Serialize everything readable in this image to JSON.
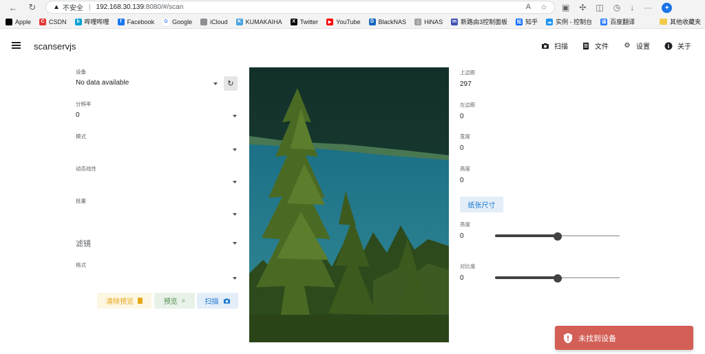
{
  "browser": {
    "insecure_label": "不安全",
    "url_host": "192.168.30.139",
    "url_path": ":8080/#/scan",
    "bookmarks": [
      {
        "label": "Apple",
        "color": "#000000",
        "glyph": ""
      },
      {
        "label": "CSDN",
        "color": "#e53935",
        "glyph": "C"
      },
      {
        "label": "哔哩哔哩",
        "color": "#00a1d6",
        "glyph": "b"
      },
      {
        "label": "Facebook",
        "color": "#1877f2",
        "glyph": "f"
      },
      {
        "label": "Google",
        "color": "#ffffff",
        "glyph": "G"
      },
      {
        "label": "iCloud",
        "color": "#8e8e93",
        "glyph": ""
      },
      {
        "label": "KUMAKAIHA",
        "color": "#4aa3df",
        "glyph": "K"
      },
      {
        "label": "Twitter",
        "color": "#000000",
        "glyph": "X"
      },
      {
        "label": "YouTube",
        "color": "#ff0000",
        "glyph": "▶"
      },
      {
        "label": "BlackNAS",
        "color": "#1565c0",
        "glyph": "D"
      },
      {
        "label": "HiNAS",
        "color": "#9e9e9e",
        "glyph": "▯"
      },
      {
        "label": "新路由3控制面板",
        "color": "#3f51b5",
        "glyph": "m"
      },
      {
        "label": "知乎",
        "color": "#0066ff",
        "glyph": "知"
      },
      {
        "label": "实例 - 控制台",
        "color": "#2196f3",
        "glyph": "☁"
      },
      {
        "label": "百度翻译",
        "color": "#2979ff",
        "glyph": "译"
      }
    ],
    "other_bookmarks": "其他收藏夹"
  },
  "app": {
    "title": "scanservjs",
    "menu": {
      "scan": "扫描",
      "files": "文件",
      "settings": "设置",
      "about": "关于"
    }
  },
  "form": {
    "device": {
      "label": "设备",
      "value": "No data available"
    },
    "resolution": {
      "label": "分辨率",
      "value": "0"
    },
    "mode": {
      "label": "模式",
      "value": ""
    },
    "dynamic_lineart": {
      "label": "动态线性",
      "value": ""
    },
    "batch": {
      "label": "批量",
      "value": ""
    },
    "filters": {
      "label": "滤镜"
    },
    "format": {
      "label": "格式",
      "value": ""
    },
    "buttons": {
      "clear": "清除预览",
      "preview": "预览",
      "scan": "扫描"
    }
  },
  "right": {
    "top": {
      "label": "上边距",
      "value": "297"
    },
    "left": {
      "label": "左边距",
      "value": "0"
    },
    "width": {
      "label": "宽度",
      "value": "0"
    },
    "height": {
      "label": "高度",
      "value": "0"
    },
    "paper_size": "纸张尺寸",
    "brightness": {
      "label": "亮度",
      "value": "0",
      "fraction": 0.5
    },
    "contrast": {
      "label": "对比度",
      "value": "0",
      "fraction": 0.5
    }
  },
  "toast": {
    "message": "未找到设备"
  }
}
